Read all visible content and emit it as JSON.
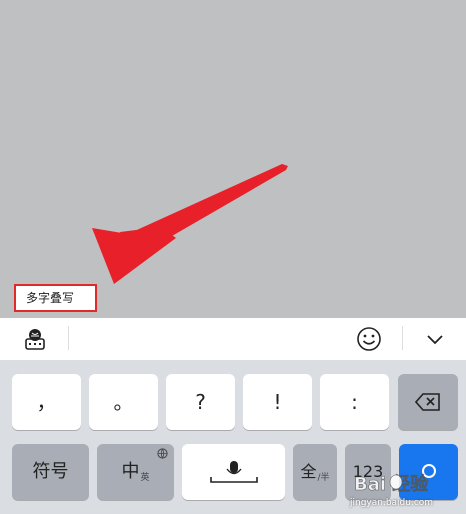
{
  "hint": {
    "label": "多字叠写"
  },
  "colors": {
    "arrow": "#e8202a",
    "highlight_border": "#e02a2a",
    "enter_key": "#1877ef"
  },
  "toolbar": {
    "left_icon": "keyboard-globe-icon",
    "smiley_icon": "smiley-icon",
    "collapse_icon": "chevron-down-icon"
  },
  "keys": {
    "comma": "，",
    "period": "。",
    "question": "?",
    "exclamation": "!",
    "colon": ":",
    "backspace_icon": "backspace-icon",
    "symbols": "符号",
    "chinese": "中",
    "chinese_sub": "英",
    "space_icon": "microphone-icon",
    "fullwidth": "全",
    "fullwidth_sub": "/半",
    "numbers": "123",
    "enter_icon": "search-icon"
  },
  "watermark": {
    "brand": "Bai 经验",
    "url": "jingyan.baidu.com"
  }
}
